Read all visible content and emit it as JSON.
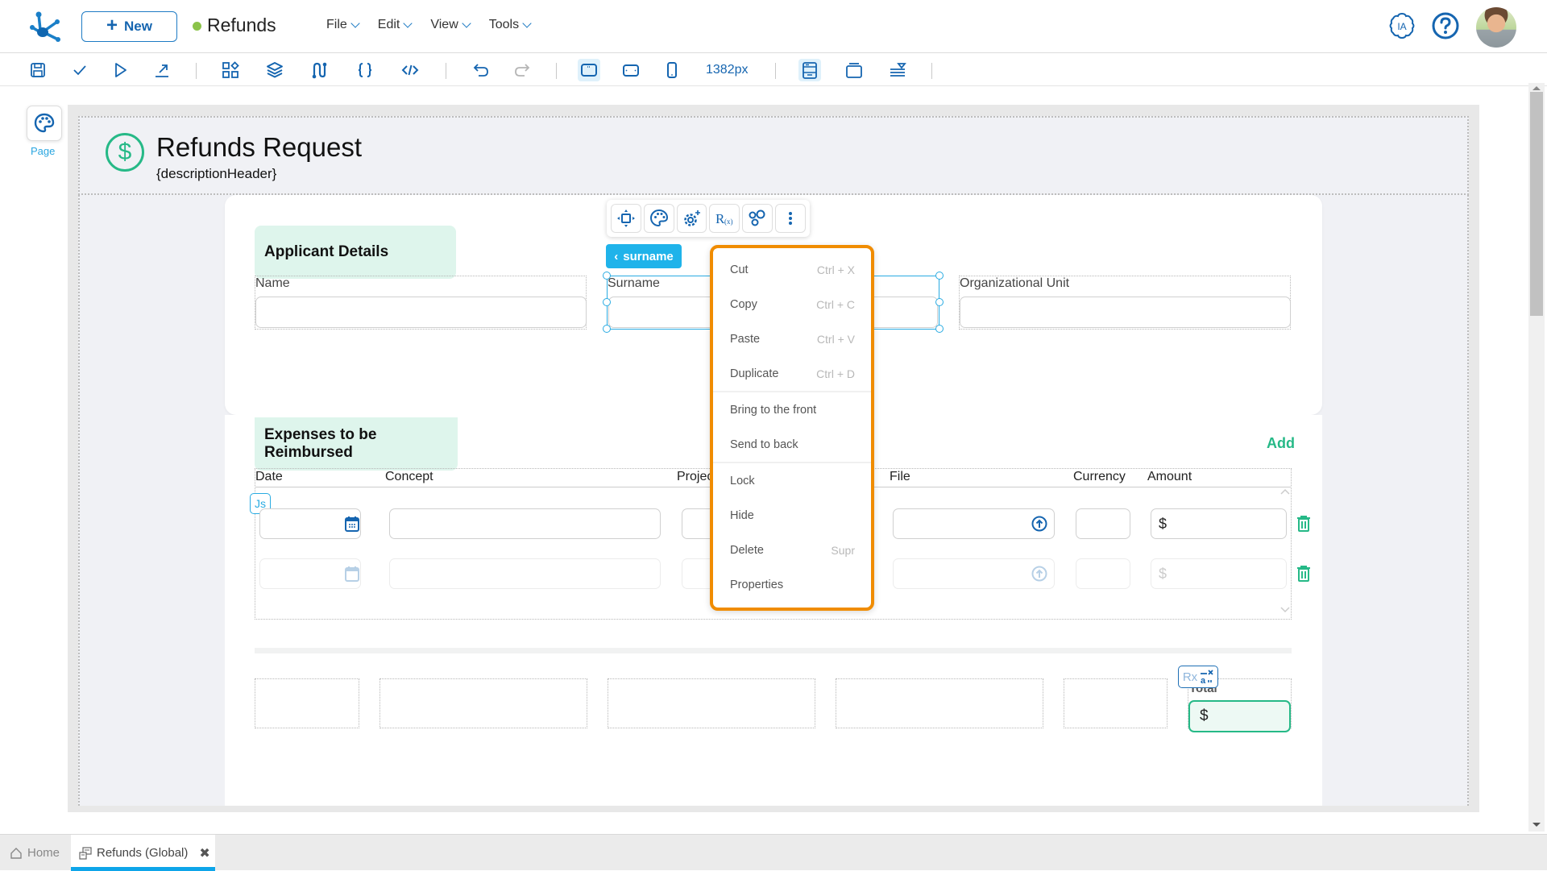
{
  "header": {
    "new_button": "New",
    "app_title": "Refunds",
    "status_color": "#8bc34a",
    "menus": [
      {
        "label": "File"
      },
      {
        "label": "Edit"
      },
      {
        "label": "View"
      },
      {
        "label": "Tools"
      }
    ],
    "ia_label": "IA",
    "help_icon": "help-circle-icon",
    "avatar": "user-avatar"
  },
  "toolbar": {
    "buttons": [
      "save-icon",
      "check-icon",
      "play-icon",
      "export-icon",
      "components-icon",
      "layers-icon",
      "flow-icon",
      "braces-icon",
      "code-icon",
      "undo-icon",
      "redo-icon",
      "desktop-view-icon",
      "tablet-view-icon",
      "mobile-view-icon",
      "layout-header-icon",
      "layout-window-icon",
      "layout-align-icon"
    ],
    "width_label": "1382px"
  },
  "palette": {
    "page_label": "Page"
  },
  "form": {
    "title": "Refunds Request",
    "subtitle": "{descriptionHeader}",
    "applicant_section": "Applicant Details",
    "fields": {
      "name": "Name",
      "surname": "Surname",
      "org_unit": "Organizational Unit"
    },
    "selected_chip": "surname",
    "expenses_section": "Expenses to be Reimbursed",
    "add_label": "Add",
    "columns": [
      "Date",
      "Concept",
      "Project",
      "File",
      "Currency",
      "Amount"
    ],
    "currency_symbol": "$",
    "js_badge": "Js",
    "total_label": "Total",
    "total_value": "$",
    "rx_badge": "Rx"
  },
  "floating_tools": [
    "move-icon",
    "palette-icon",
    "settings-sparkle-icon",
    "rules-fx-icon",
    "connections-icon",
    "more-vertical-icon"
  ],
  "context_menu": {
    "groups": [
      [
        {
          "label": "Cut",
          "shortcut": "Ctrl + X"
        },
        {
          "label": "Copy",
          "shortcut": "Ctrl + C"
        },
        {
          "label": "Paste",
          "shortcut": "Ctrl + V"
        },
        {
          "label": "Duplicate",
          "shortcut": "Ctrl + D"
        }
      ],
      [
        {
          "label": "Bring to the front",
          "shortcut": ""
        },
        {
          "label": "Send to back",
          "shortcut": ""
        }
      ],
      [
        {
          "label": "Lock",
          "shortcut": ""
        },
        {
          "label": "Hide",
          "shortcut": ""
        },
        {
          "label": "Delete",
          "shortcut": "Supr"
        },
        {
          "label": "Properties",
          "shortcut": ""
        }
      ]
    ],
    "accent_color": "#f08c00"
  },
  "tabs": {
    "home": "Home",
    "active": "Refunds (Global)"
  },
  "colors": {
    "brand_blue": "#1565b0",
    "accent_green": "#26b987",
    "selection_blue": "#29abe2"
  }
}
